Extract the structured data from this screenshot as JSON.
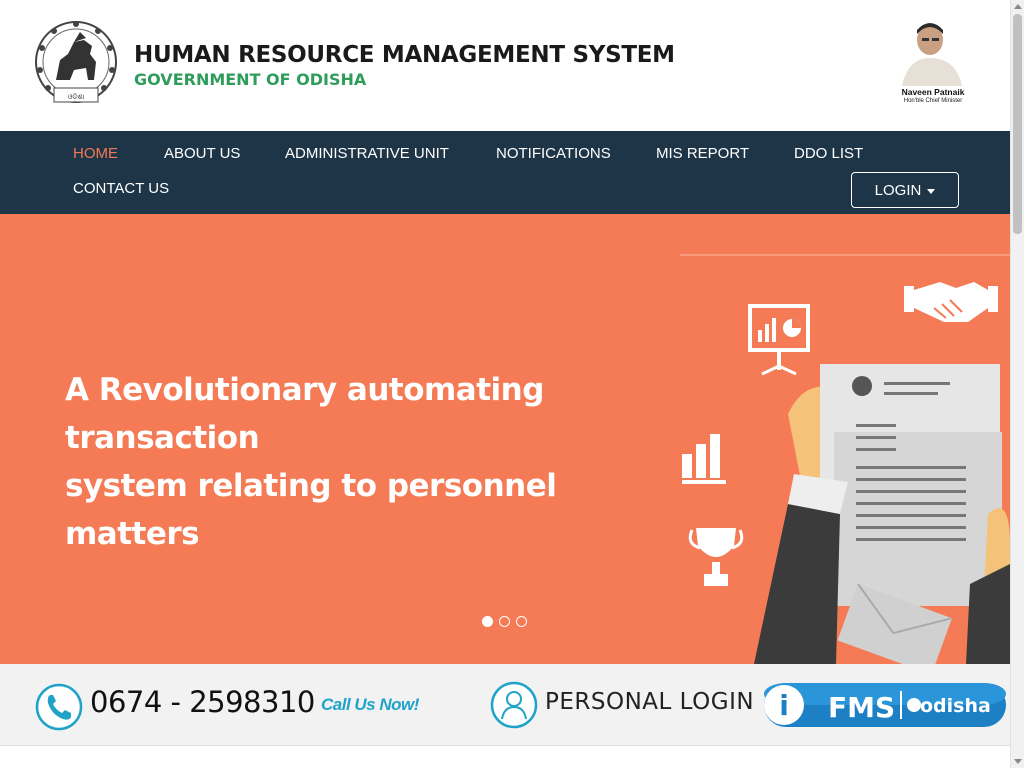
{
  "header": {
    "title": "HUMAN RESOURCE MANAGEMENT SYSTEM",
    "subtitle": "GOVERNMENT OF ODISHA",
    "emblem_text": "ଓଡ଼ିଶା ସରକାର",
    "cm_name": "Naveen Patnaik",
    "cm_role": "Hon'ble Chief Minister"
  },
  "nav": {
    "items": [
      {
        "label": "HOME",
        "active": true
      },
      {
        "label": "ABOUT US"
      },
      {
        "label": "ADMINISTRATIVE UNIT"
      },
      {
        "label": "NOTIFICATIONS"
      },
      {
        "label": "MIS REPORT"
      },
      {
        "label": "DDO LIST"
      },
      {
        "label": "CONTACT US"
      }
    ],
    "login_label": "LOGIN"
  },
  "hero": {
    "line1": "A Revolutionary automating",
    "line2": "transaction",
    "line3": "system relating to personnel matters",
    "slide_count": 3,
    "active_slide": 1
  },
  "contact": {
    "phone": "0674 - 2598310",
    "call_now": "Call Us Now!",
    "personal_login": "PERSONAL LOGIN",
    "ifms_text": "FMS",
    "ifms_i": "i",
    "ifms_region": "odisha"
  },
  "colors": {
    "nav_bg": "#1e3547",
    "accent": "#f47b55",
    "green": "#2e9c5a",
    "link_blue": "#1fa3c8"
  }
}
